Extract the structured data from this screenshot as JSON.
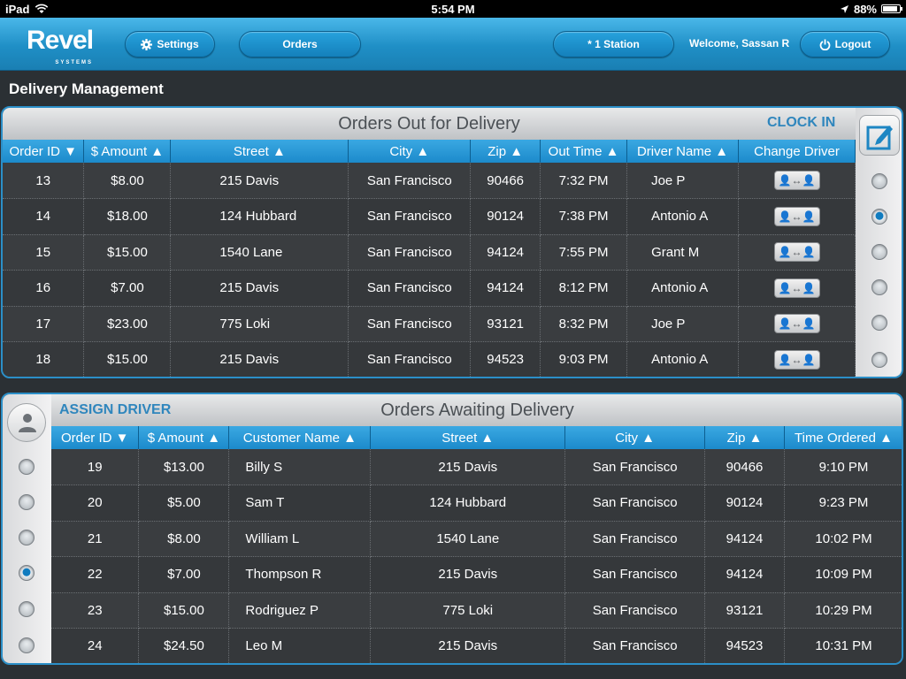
{
  "status_bar": {
    "device": "iPad",
    "time": "5:54 PM",
    "battery": "88%"
  },
  "header": {
    "logo": "Revel",
    "logo_sub": "SYSTEMS",
    "settings_label": "Settings",
    "orders_label": "Orders",
    "station_label": "* 1 Station",
    "welcome": "Welcome, Sassan R",
    "logout_label": "Logout"
  },
  "page_title": "Delivery Management",
  "out_for_delivery": {
    "title": "Orders Out for Delivery",
    "action": "CLOCK IN",
    "columns": [
      "Order ID ▼",
      "$ Amount ▲",
      "Street ▲",
      "City ▲",
      "Zip ▲",
      "Out Time ▲",
      "Driver Name ▲",
      "Change Driver"
    ],
    "rows": [
      {
        "id": "13",
        "amount": "$8.00",
        "street": "215 Davis",
        "city": "San Francisco",
        "zip": "90466",
        "time": "7:32 PM",
        "driver": "Joe P",
        "selected": false
      },
      {
        "id": "14",
        "amount": "$18.00",
        "street": "124 Hubbard",
        "city": "San Francisco",
        "zip": "90124",
        "time": "7:38 PM",
        "driver": "Antonio A",
        "selected": true
      },
      {
        "id": "15",
        "amount": "$15.00",
        "street": "1540 Lane",
        "city": "San Francisco",
        "zip": "94124",
        "time": "7:55 PM",
        "driver": "Grant M",
        "selected": false
      },
      {
        "id": "16",
        "amount": "$7.00",
        "street": "215 Davis",
        "city": "San Francisco",
        "zip": "94124",
        "time": "8:12 PM",
        "driver": "Antonio A",
        "selected": false
      },
      {
        "id": "17",
        "amount": "$23.00",
        "street": "775 Loki",
        "city": "San Francisco",
        "zip": "93121",
        "time": "8:32 PM",
        "driver": "Joe P",
        "selected": false
      },
      {
        "id": "18",
        "amount": "$15.00",
        "street": "215 Davis",
        "city": "San Francisco",
        "zip": "94523",
        "time": "9:03 PM",
        "driver": "Antonio A",
        "selected": false
      }
    ]
  },
  "awaiting_delivery": {
    "title": "Orders Awaiting Delivery",
    "action": "ASSIGN DRIVER",
    "columns": [
      "Order ID ▼",
      "$ Amount ▲",
      "Customer Name ▲",
      "Street ▲",
      "City ▲",
      "Zip ▲",
      "Time Ordered ▲"
    ],
    "rows": [
      {
        "id": "19",
        "amount": "$13.00",
        "customer": "Billy S",
        "street": "215 Davis",
        "city": "San Francisco",
        "zip": "90466",
        "time": "9:10 PM",
        "selected": false
      },
      {
        "id": "20",
        "amount": "$5.00",
        "customer": "Sam T",
        "street": "124 Hubbard",
        "city": "San Francisco",
        "zip": "90124",
        "time": "9:23 PM",
        "selected": false
      },
      {
        "id": "21",
        "amount": "$8.00",
        "customer": "William L",
        "street": "1540 Lane",
        "city": "San Francisco",
        "zip": "94124",
        "time": "10:02 PM",
        "selected": false
      },
      {
        "id": "22",
        "amount": "$7.00",
        "customer": "Thompson R",
        "street": "215 Davis",
        "city": "San Francisco",
        "zip": "94124",
        "time": "10:09 PM",
        "selected": true
      },
      {
        "id": "23",
        "amount": "$15.00",
        "customer": "Rodriguez P",
        "street": "775 Loki",
        "city": "San Francisco",
        "zip": "93121",
        "time": "10:29 PM",
        "selected": false
      },
      {
        "id": "24",
        "amount": "$24.50",
        "customer": "Leo M",
        "street": "215 Davis",
        "city": "San Francisco",
        "zip": "94523",
        "time": "10:31 PM",
        "selected": false
      }
    ]
  }
}
